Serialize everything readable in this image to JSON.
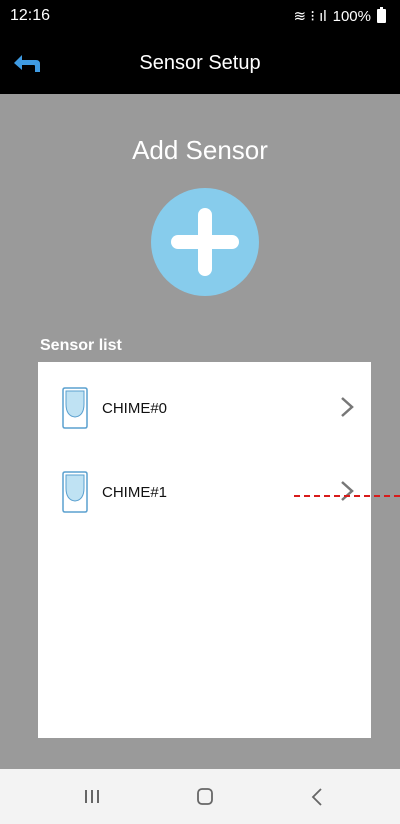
{
  "status_bar": {
    "time": "12:16",
    "signal": "≋ ⁝ ıl",
    "battery": "100%"
  },
  "app_bar": {
    "title": "Sensor Setup",
    "back_icon": "back-arrow-icon"
  },
  "add_sensor": {
    "title": "Add Sensor",
    "icon": "plus-icon",
    "color": "#87ccec"
  },
  "sensor_list": {
    "label": "Sensor list",
    "items": [
      {
        "name": "CHIME#0",
        "icon": "chime-icon"
      },
      {
        "name": "CHIME#1",
        "icon": "chime-icon"
      }
    ]
  },
  "nav_bar": {
    "buttons": [
      "recent-apps-icon",
      "home-icon",
      "back-icon"
    ]
  }
}
